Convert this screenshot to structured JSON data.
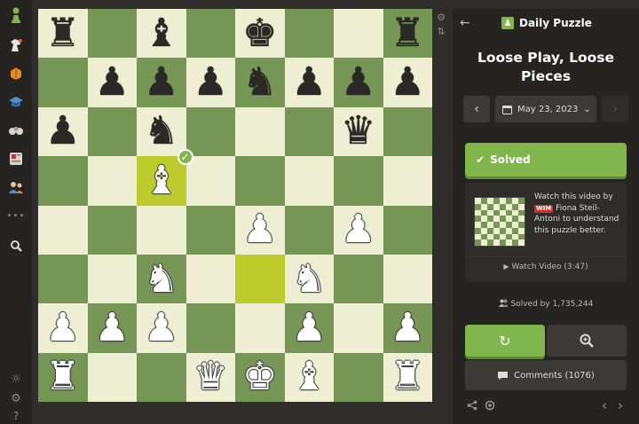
{
  "nav": {
    "items": [
      {
        "name": "home-pawn-icon"
      },
      {
        "name": "play-icon"
      },
      {
        "name": "puzzles-icon"
      },
      {
        "name": "learn-icon"
      },
      {
        "name": "watch-icon"
      },
      {
        "name": "news-icon"
      },
      {
        "name": "social-icon"
      },
      {
        "name": "more-icon",
        "glyph": "•••"
      },
      {
        "name": "search-icon"
      }
    ],
    "bottom": [
      {
        "name": "theme-icon",
        "glyph": "☼"
      },
      {
        "name": "settings-icon",
        "glyph": "⚙"
      },
      {
        "name": "help-icon",
        "glyph": "?"
      }
    ]
  },
  "board": {
    "light_color": "#eeeed2",
    "dark_color": "#769656",
    "highlight_color": "#bbcb2b",
    "rows": [
      [
        "br",
        "",
        "bb",
        "",
        "bk",
        "",
        "",
        "br"
      ],
      [
        "",
        "bp",
        "bp",
        "bp",
        "bn",
        "bp",
        "bp",
        "bp"
      ],
      [
        "bp",
        "",
        "bn",
        "",
        "",
        "",
        "bq",
        ""
      ],
      [
        "",
        "",
        "wb",
        "",
        "",
        "",
        "",
        ""
      ],
      [
        "",
        "",
        "",
        "",
        "wp",
        "",
        "wp",
        ""
      ],
      [
        "",
        "",
        "wn",
        "",
        "",
        "wn",
        "",
        ""
      ],
      [
        "wp",
        "wp",
        "wp",
        "",
        "",
        "wp",
        "",
        "wp"
      ],
      [
        "wr",
        "",
        "",
        "wq",
        "wk",
        "wb",
        "",
        "wr"
      ]
    ],
    "highlights": [
      [
        3,
        2
      ],
      [
        5,
        4
      ]
    ],
    "check_square": [
      3,
      2
    ],
    "check_glyph": "✓"
  },
  "side_tools": {
    "settings_glyph": "⚙",
    "flip_glyph": "⇅"
  },
  "panel": {
    "back_glyph": "←",
    "header_title": "Daily Puzzle",
    "puzzle_title_line1": "Loose Play, Loose",
    "puzzle_title_line2": "Pieces",
    "date_prev_glyph": "‹",
    "date_next_glyph": "›",
    "date_label": "May 23, 2023",
    "date_caret": "⌄",
    "solved_check": "✔",
    "solved_label": "Solved",
    "video": {
      "text_prefix": "Watch this video by",
      "title_badge": "WIM",
      "text_suffix": "Fiona Steil-Antoni to understand this puzzle better.",
      "watch_glyph": "▶",
      "watch_label": "Watch Video (3:47)"
    },
    "solved_by_label": "Solved by 1,735,244",
    "retry_glyph": "↻",
    "comments_label": "Comments  (1076)",
    "footer": {
      "share_glyph": "⋖",
      "prev_glyph": "‹",
      "next_glyph": "›"
    }
  }
}
